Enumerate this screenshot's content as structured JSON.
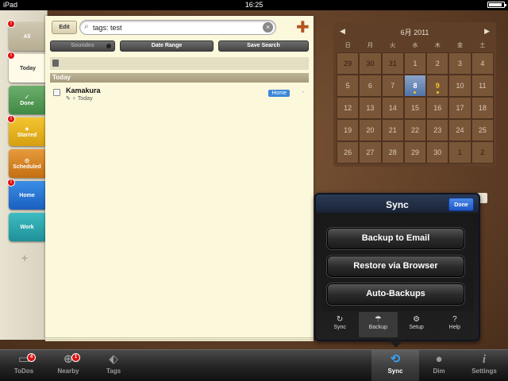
{
  "status_bar": {
    "device": "iPad",
    "time": "16:25"
  },
  "categories": [
    {
      "label": "All",
      "badge": "!"
    },
    {
      "label": "Today",
      "badge": "!"
    },
    {
      "label": "Done",
      "icon": "✓"
    },
    {
      "label": "Starred",
      "badge": "!",
      "icon": "★"
    },
    {
      "label": "Scheduled",
      "icon": "⊙"
    },
    {
      "label": "Home",
      "badge": "!"
    },
    {
      "label": "Work"
    }
  ],
  "add_category": "+",
  "toolbar": {
    "edit_label": "Edit",
    "search_value": "tags: test",
    "add_label": "✚",
    "soundex_label": "Soundex",
    "date_range_label": "Date Range",
    "save_search_label": "Save Search"
  },
  "list": {
    "section_title": "Today",
    "items": [
      {
        "title": "Kamakura",
        "subtitle": "Today",
        "tag": "Home",
        "trail": "-"
      }
    ]
  },
  "calendar": {
    "month_title": "6月 2011",
    "prev": "◀",
    "next": "▶",
    "weekdays": [
      "日",
      "月",
      "火",
      "水",
      "木",
      "金",
      "土"
    ],
    "weeks": [
      [
        "29",
        "30",
        "31",
        "1",
        "2",
        "3",
        "4"
      ],
      [
        "5",
        "6",
        "7",
        "8",
        "9",
        "10",
        "11"
      ],
      [
        "12",
        "13",
        "14",
        "15",
        "16",
        "17",
        "18"
      ],
      [
        "19",
        "20",
        "21",
        "22",
        "23",
        "24",
        "25"
      ],
      [
        "26",
        "27",
        "28",
        "29",
        "30",
        "1",
        "2"
      ]
    ]
  },
  "sync_popover": {
    "title": "Sync",
    "done_label": "Done",
    "buttons": [
      "Backup to Email",
      "Restore via Browser",
      "Auto-Backups"
    ],
    "tabs": [
      {
        "label": "Sync",
        "icon": "↻"
      },
      {
        "label": "Backup",
        "icon": "☂"
      },
      {
        "label": "Setup",
        "icon": "⚙"
      },
      {
        "label": "Help",
        "icon": "?"
      }
    ]
  },
  "tabbar": [
    {
      "label": "ToDos",
      "badge": "4"
    },
    {
      "label": "Nearby",
      "badge": "1"
    },
    {
      "label": "Tags"
    },
    {
      "label": "Sync"
    },
    {
      "label": "Dim"
    },
    {
      "label": "Settings"
    }
  ]
}
